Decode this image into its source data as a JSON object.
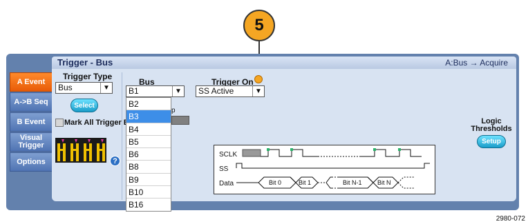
{
  "callout": {
    "number": "5"
  },
  "header": {
    "title": "Trigger - Bus",
    "status": "A:Bus → Acquire"
  },
  "tabs": [
    {
      "label": "A Event",
      "active": true
    },
    {
      "label": "A->B Seq",
      "active": false
    },
    {
      "label": "B Event",
      "active": false
    },
    {
      "label": "Visual Trigger",
      "active": false
    },
    {
      "label": "Options",
      "active": false
    }
  ],
  "trigger_type": {
    "label": "Trigger Type",
    "value": "Bus",
    "select_label": "Select"
  },
  "mark_all": {
    "label": "Mark All Trigger Events in Record",
    "checked": false
  },
  "bus": {
    "label": "Bus",
    "value": "B1",
    "options": [
      "B2",
      "B3",
      "B4",
      "B5",
      "B6",
      "B8",
      "B9",
      "B10",
      "B16"
    ],
    "highlighted": "B3"
  },
  "trigger_on": {
    "label": "Trigger On",
    "value": "SS Active"
  },
  "partial_label": "p",
  "logic": {
    "label": "Logic Thresholds",
    "button": "Setup"
  },
  "timing": {
    "sclk": "SCLK",
    "ss": "SS",
    "data": "Data",
    "bit0": "Bit 0",
    "bit1": "Bit 1",
    "bitn1": "Bit N-1",
    "bitn": "Bit N"
  },
  "footnote": "2980-072",
  "colors": {
    "active_tab": "#f47a1f",
    "panel": "#6381ad",
    "content": "#d8e3f2",
    "highlight": "#3d8ee8",
    "callout": "#f5a623"
  }
}
